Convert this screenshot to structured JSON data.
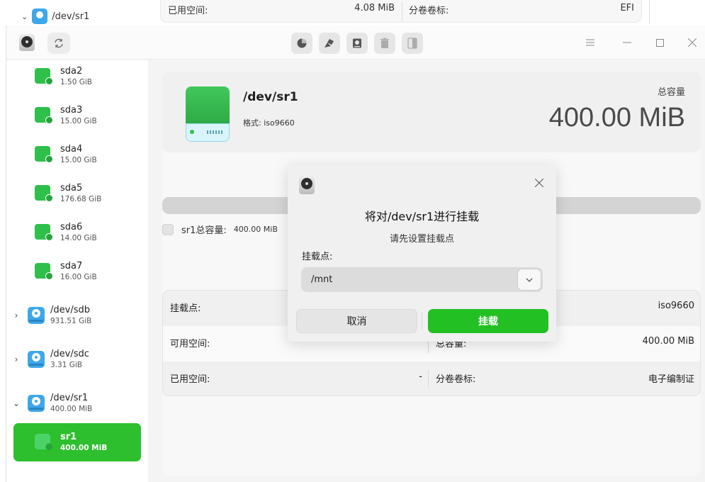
{
  "background": {
    "tree_item": "/dev/sr1",
    "used_label": "已用空间:",
    "used_value": "4.08 MiB",
    "label_label": "分卷卷标:",
    "label_value": "EFI"
  },
  "sidebar": {
    "partitions": [
      {
        "name": "sda2",
        "size": "1.50 GiB"
      },
      {
        "name": "sda3",
        "size": "15.00 GiB"
      },
      {
        "name": "sda4",
        "size": "15.00 GiB"
      },
      {
        "name": "sda5",
        "size": "176.68 GiB"
      },
      {
        "name": "sda6",
        "size": "14.00 GiB"
      },
      {
        "name": "sda7",
        "size": "16.00 GiB"
      }
    ],
    "disks": [
      {
        "name": "/dev/sdb",
        "size": "931.51 GiB",
        "expanded": false
      },
      {
        "name": "/dev/sdc",
        "size": "3.31 GiB",
        "expanded": false
      },
      {
        "name": "/dev/sr1",
        "size": "400.00 MiB",
        "expanded": true
      }
    ],
    "selected": {
      "name": "sr1",
      "size": "400.00 MiB"
    }
  },
  "summary": {
    "device": "/dev/sr1",
    "format": "格式: iso9660",
    "capacity_label": "总容量",
    "capacity_value": "400.00 MiB"
  },
  "legend": {
    "label": "sr1总容量:",
    "value": "400.00 MiB"
  },
  "info": {
    "rows": [
      {
        "k1": "挂载点:",
        "v1": "",
        "k2": "",
        "v2": "iso9660"
      },
      {
        "k1": "可用空间:",
        "v1": "-",
        "k2": "总容量:",
        "v2": "400.00 MiB"
      },
      {
        "k1": "已用空间:",
        "v1": "-",
        "k2": "分卷卷标:",
        "v2": "电子编制证"
      }
    ]
  },
  "dialog": {
    "title": "将对/dev/sr1进行挂载",
    "subtitle": "请先设置挂载点",
    "field_label": "挂载点:",
    "mount_point": "/mnt",
    "cancel": "取消",
    "confirm": "挂载"
  },
  "colors": {
    "accent": "#22c022",
    "partition_green": "#2ec04a",
    "disk_blue": "#3ea7e9"
  },
  "icons": {
    "toolbar": [
      "pie-chart-icon",
      "format-brush-icon",
      "mount-icon",
      "delete-icon",
      "split-icon"
    ],
    "window": [
      "menu-icon",
      "minimize-icon",
      "maximize-icon",
      "close-icon"
    ]
  }
}
